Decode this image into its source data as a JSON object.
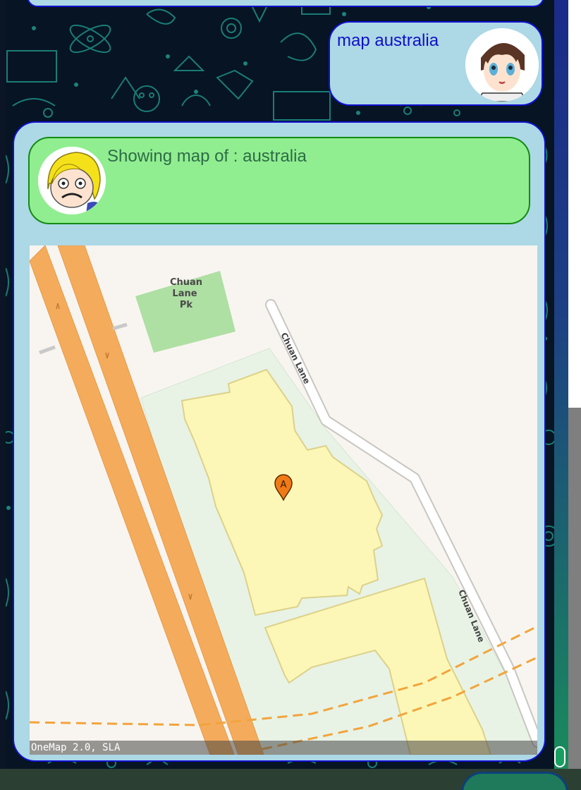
{
  "conversation": {
    "user_message": {
      "text": "map australia",
      "avatar_icon": "anime-boy-avatar-icon"
    },
    "bot_message": {
      "text": "Showing map of : australia",
      "avatar_icon": "cartoon-blonde-avatar-icon"
    }
  },
  "map": {
    "attribution": "OneMap 2.0, SLA",
    "park_label": [
      "Chuan",
      "Lane",
      "Pk"
    ],
    "road_label_upper": "Chuan Lane",
    "road_label_lower": "Chuan Lane",
    "marker_letter": "A"
  },
  "colors": {
    "user_bubble": "#add8e6",
    "bot_header": "#90ee90",
    "bubble_border": "#1010d0",
    "user_text": "#1010c8",
    "bot_text": "#2e6b47"
  }
}
